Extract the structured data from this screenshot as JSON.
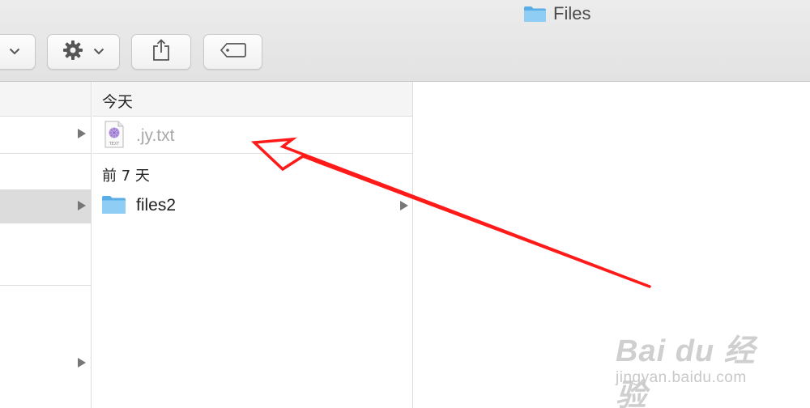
{
  "window": {
    "title": "Files",
    "title_icon": "folder-icon"
  },
  "toolbar": {
    "view_button": {
      "icon": "chevron-down-icon"
    },
    "action_button": {
      "icon": "gear-icon",
      "menu_icon": "chevron-down-icon"
    },
    "share_button": {
      "icon": "share-icon"
    },
    "tags_button": {
      "icon": "tag-icon"
    }
  },
  "column1": {
    "rows": [
      {
        "has_arrow": true,
        "selected": false
      },
      {
        "has_arrow": false,
        "selected": false
      },
      {
        "has_arrow": true,
        "selected": true
      },
      {
        "has_arrow": false,
        "selected": false
      },
      {
        "has_arrow": true,
        "selected": false
      }
    ]
  },
  "column2": {
    "header": "今天",
    "groups": [
      {
        "label": "今天",
        "items": [
          {
            "name": ".jy.txt",
            "type": "text-file",
            "hidden": true,
            "has_arrow": false
          }
        ]
      },
      {
        "label": "前 7 天",
        "items": [
          {
            "name": "files2",
            "type": "folder",
            "hidden": false,
            "has_arrow": true
          }
        ]
      }
    ]
  },
  "annotation": {
    "type": "red-arrow",
    "color": "#ff0000",
    "points_to": ".jy.txt"
  },
  "watermark": {
    "line1": "Bai du 经验",
    "line2": "jingyan.baidu.com"
  },
  "colors": {
    "folder": "#7cc3f0",
    "selection": "#dcdcdc",
    "hidden_text": "#a8a8a8",
    "arrow": "#ff0000"
  }
}
